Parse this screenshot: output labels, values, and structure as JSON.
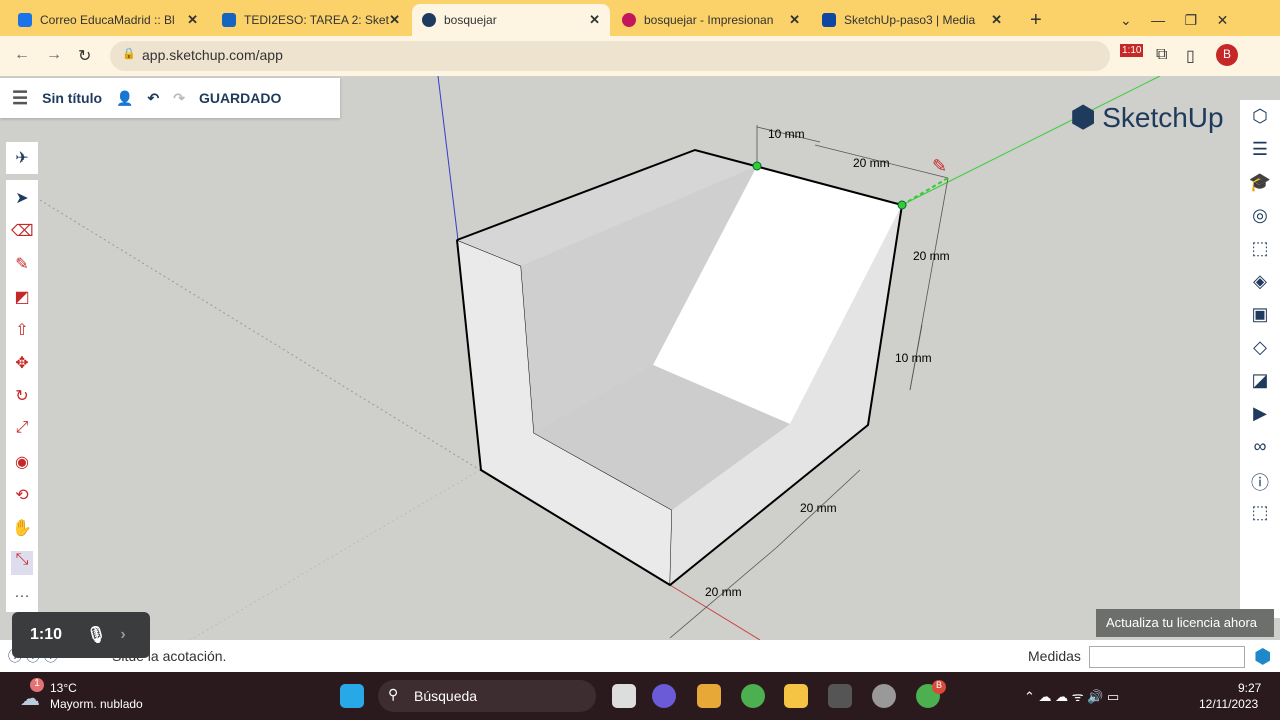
{
  "browser": {
    "tabs": [
      {
        "label": "Correo EducaMadrid :: Bl",
        "color": "#1a73e8"
      },
      {
        "label": "TEDI2ESO: TAREA 2: Sket",
        "color": "#1565c0"
      },
      {
        "label": "bosquejar",
        "color": "#1e3a5c",
        "active": true
      },
      {
        "label": "bosquejar - Impresionan",
        "color": "#c2185b"
      },
      {
        "label": "SketchUp-paso3 | Media",
        "color": "#0d47a1"
      }
    ],
    "url": "app.sketchup.com/app",
    "profile": "B",
    "ext_badge": "1:10"
  },
  "app": {
    "title": "Sin título",
    "saved": "GUARDADO",
    "logo": "SketchUp"
  },
  "dimensions": [
    "10 mm",
    "20 mm",
    "20 mm",
    "10 mm",
    "20 mm",
    "20 mm"
  ],
  "recorder": {
    "time": "1:10"
  },
  "license_banner": "Actualiza tu licencia ahora",
  "status": {
    "text": "Sitúe la acotación.",
    "measures_label": "Medidas",
    "measures_value": ""
  },
  "taskbar": {
    "weather_temp": "13°C",
    "weather_desc": "Mayorm. nublado",
    "weather_badge": "1",
    "search": "Búsqueda",
    "time": "9:27",
    "date": "12/11/2023",
    "chrome_badge": "B"
  }
}
